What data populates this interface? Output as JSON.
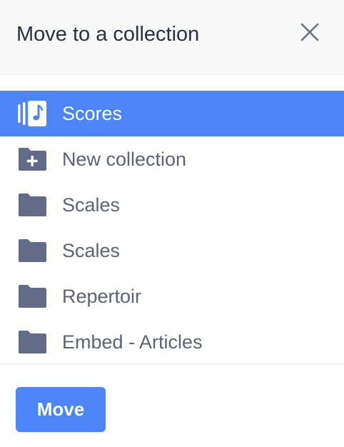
{
  "dialog": {
    "title": "Move to a collection",
    "close_icon": "close-icon",
    "accent_color": "#4b85f6"
  },
  "collections": {
    "items": [
      {
        "label": "Scores",
        "icon": "scores-icon",
        "selected": true
      },
      {
        "label": "New collection",
        "icon": "folder-plus-icon",
        "selected": false
      },
      {
        "label": "Scales",
        "icon": "folder-icon",
        "selected": false
      },
      {
        "label": "Scales",
        "icon": "folder-icon",
        "selected": false
      },
      {
        "label": "Repertoir",
        "icon": "folder-icon",
        "selected": false
      },
      {
        "label": "Embed - Articles",
        "icon": "folder-icon",
        "selected": false
      }
    ]
  },
  "footer": {
    "move_label": "Move"
  }
}
